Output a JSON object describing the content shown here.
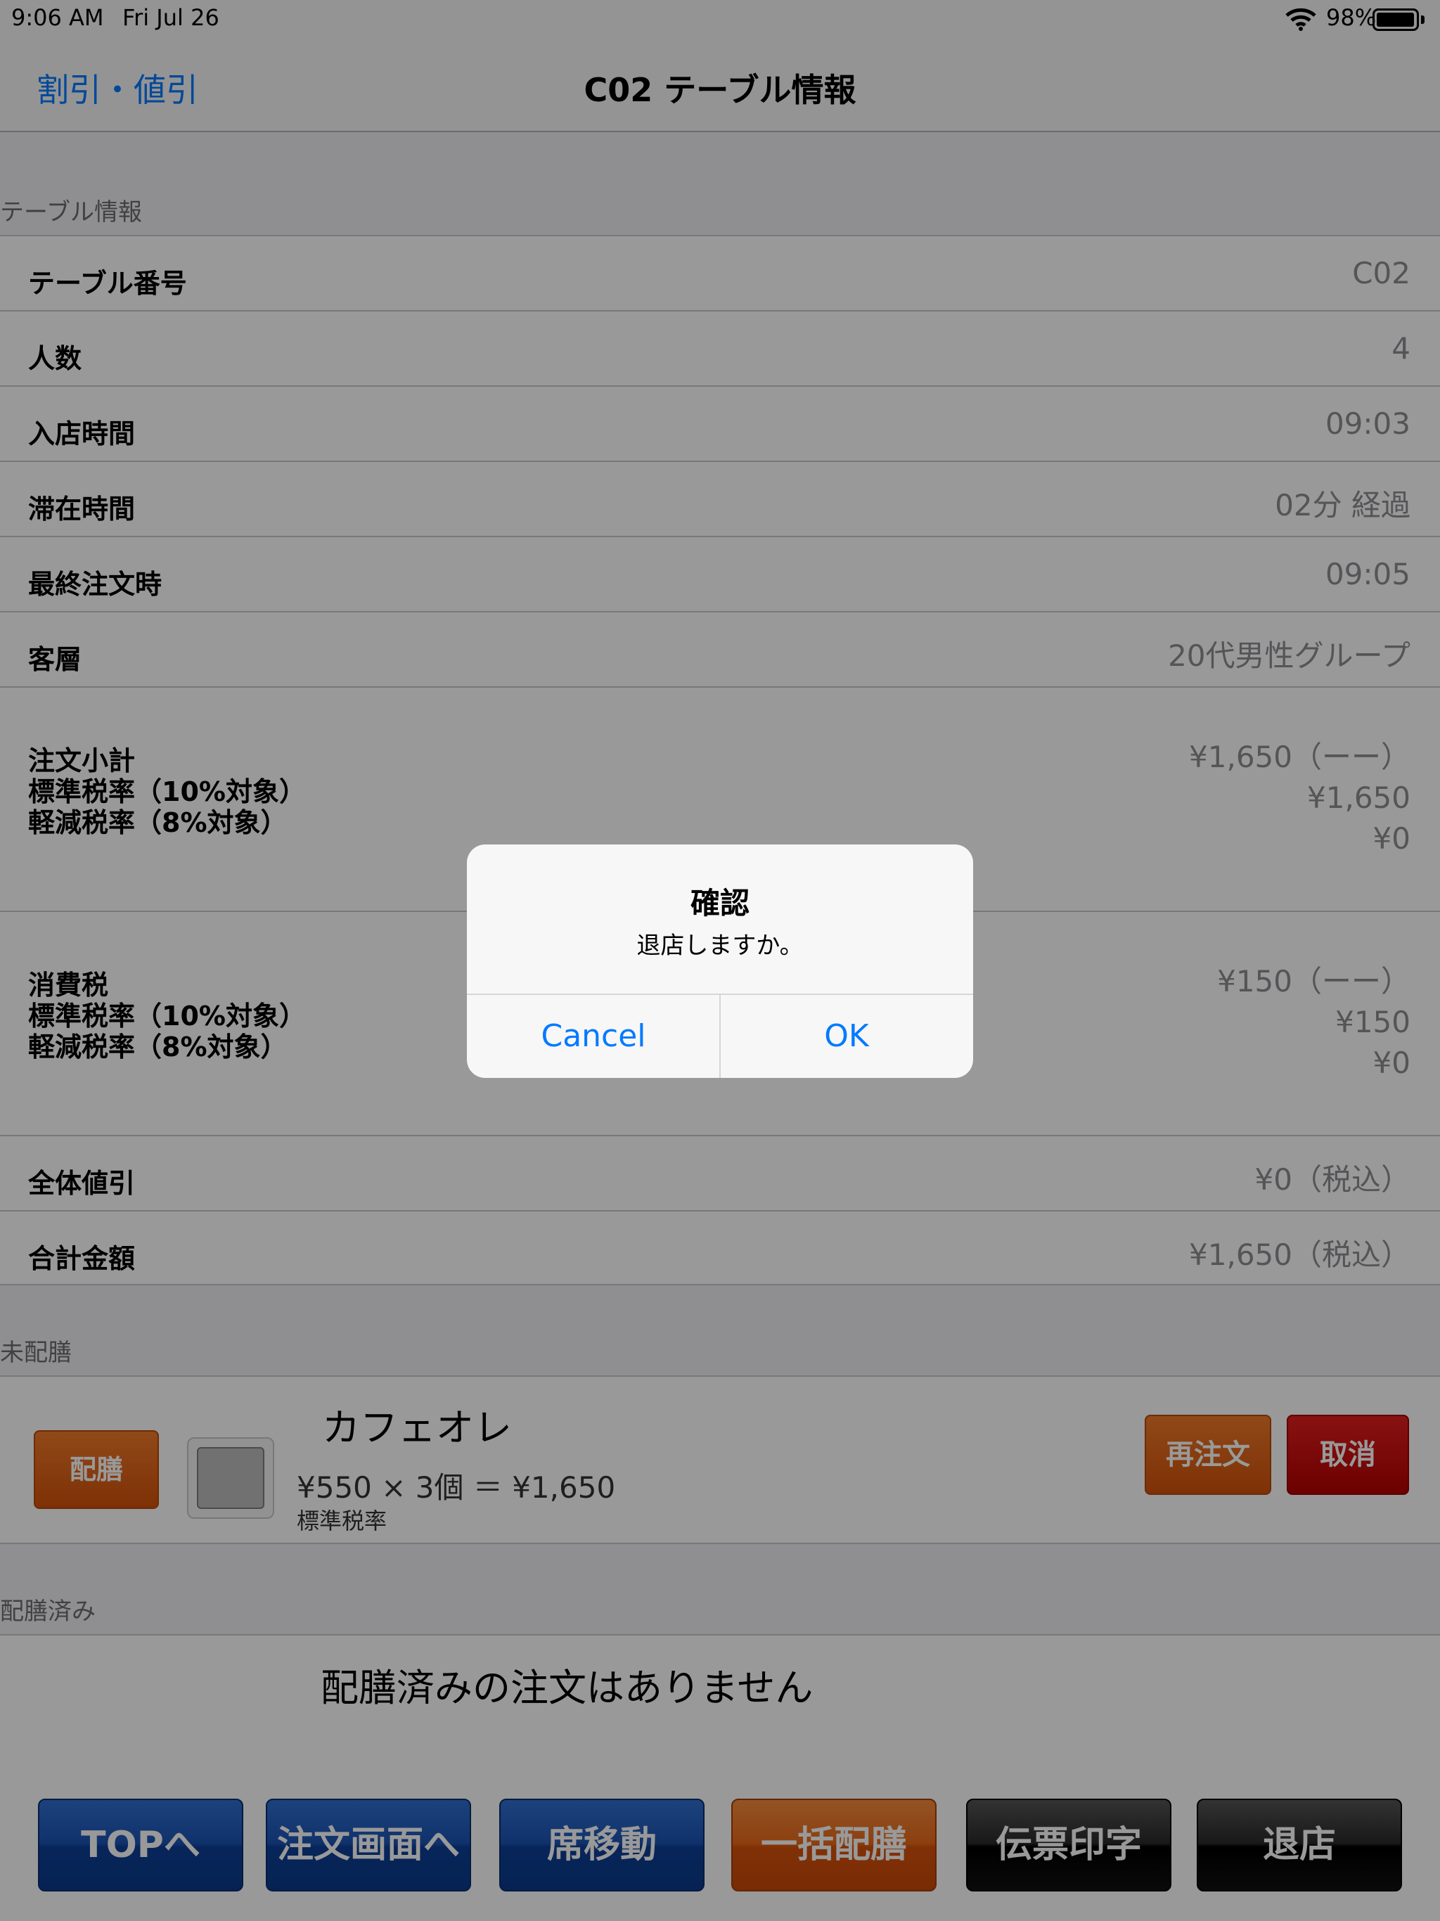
{
  "status_bar": {
    "time": "9:06 AM",
    "date": "Fri Jul 26",
    "battery": "98%",
    "battery_level": 0.98
  },
  "nav": {
    "left_button": "割引・値引",
    "title": "C02 テーブル情報"
  },
  "sections": {
    "table_info": "テーブル情報",
    "undelivered": "未配膳",
    "delivered": "配膳済み"
  },
  "table_info": {
    "rows": [
      {
        "label": "テーブル番号",
        "value": "C02"
      },
      {
        "label": "人数",
        "value": "4"
      },
      {
        "label": "入店時間",
        "value": "09:03"
      },
      {
        "label": "滞在時間",
        "value": "02分 経過"
      },
      {
        "label": "最終注文時",
        "value": "09:05"
      },
      {
        "label": "客層",
        "value": "20代男性グループ"
      }
    ],
    "subtotal": {
      "labels": [
        "注文小計",
        "標準税率（10%対象）",
        "軽減税率（8%対象）"
      ],
      "values": [
        "¥1,650（ーー）",
        "¥1,650",
        "¥0"
      ]
    },
    "tax": {
      "labels": [
        "消費税",
        "標準税率（10%対象）",
        "軽減税率（8%対象）"
      ],
      "values": [
        "¥150（ーー）",
        "¥150",
        "¥0"
      ]
    },
    "discount": {
      "label": "全体値引",
      "value": "¥0（税込）"
    },
    "total": {
      "label": "合計金額",
      "value": "¥1,650（税込）"
    }
  },
  "undelivered_item": {
    "deliver_button": "配膳",
    "name": "カフェオレ",
    "price_line": "¥550 × 3個 ＝ ¥1,650",
    "tax_type": "標準税率",
    "reorder_button": "再注文",
    "cancel_button": "取消"
  },
  "delivered_empty": "配膳済みの注文はありません",
  "toolbar": {
    "top": "TOPへ",
    "order": "注文画面へ",
    "move": "席移動",
    "deliver_all": "一括配膳",
    "print": "伝票印字",
    "checkout": "退店"
  },
  "alert": {
    "title": "確認",
    "message": "退店しますか。",
    "cancel": "Cancel",
    "ok": "OK"
  },
  "colors": {
    "ios_blue": "#007aff",
    "orange": "#e2621a",
    "red": "#c40000",
    "navy": "#1c4ea8"
  }
}
